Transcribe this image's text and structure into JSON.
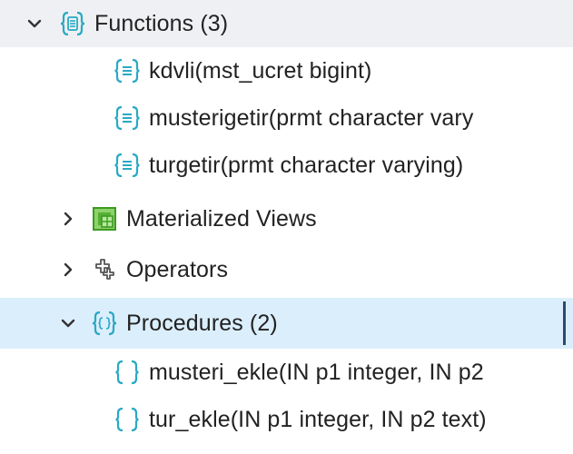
{
  "tree": {
    "functions": {
      "label": "Functions (3)",
      "expanded": true,
      "items": [
        {
          "label": "kdvli(mst_ucret bigint)"
        },
        {
          "label": "musterigetir(prmt character vary"
        },
        {
          "label": "turgetir(prmt character varying)"
        }
      ]
    },
    "materialized_views": {
      "label": "Materialized Views",
      "expanded": false
    },
    "operators": {
      "label": "Operators",
      "expanded": false
    },
    "procedures": {
      "label": "Procedures (2)",
      "expanded": true,
      "selected": true,
      "items": [
        {
          "label": "musteri_ekle(IN p1 integer, IN p2"
        },
        {
          "label": "tur_ekle(IN p1 integer, IN p2 text)"
        }
      ]
    }
  },
  "colors": {
    "function_icon": "#29a9c4",
    "procedure_icon": "#29a9c4",
    "materialized_view_icon": "#56b034",
    "operator_icon": "#555555",
    "selected_bg": "#dbeefb",
    "shaded_bg": "#eef0f3",
    "selected_marker": "#2c4a6b"
  }
}
